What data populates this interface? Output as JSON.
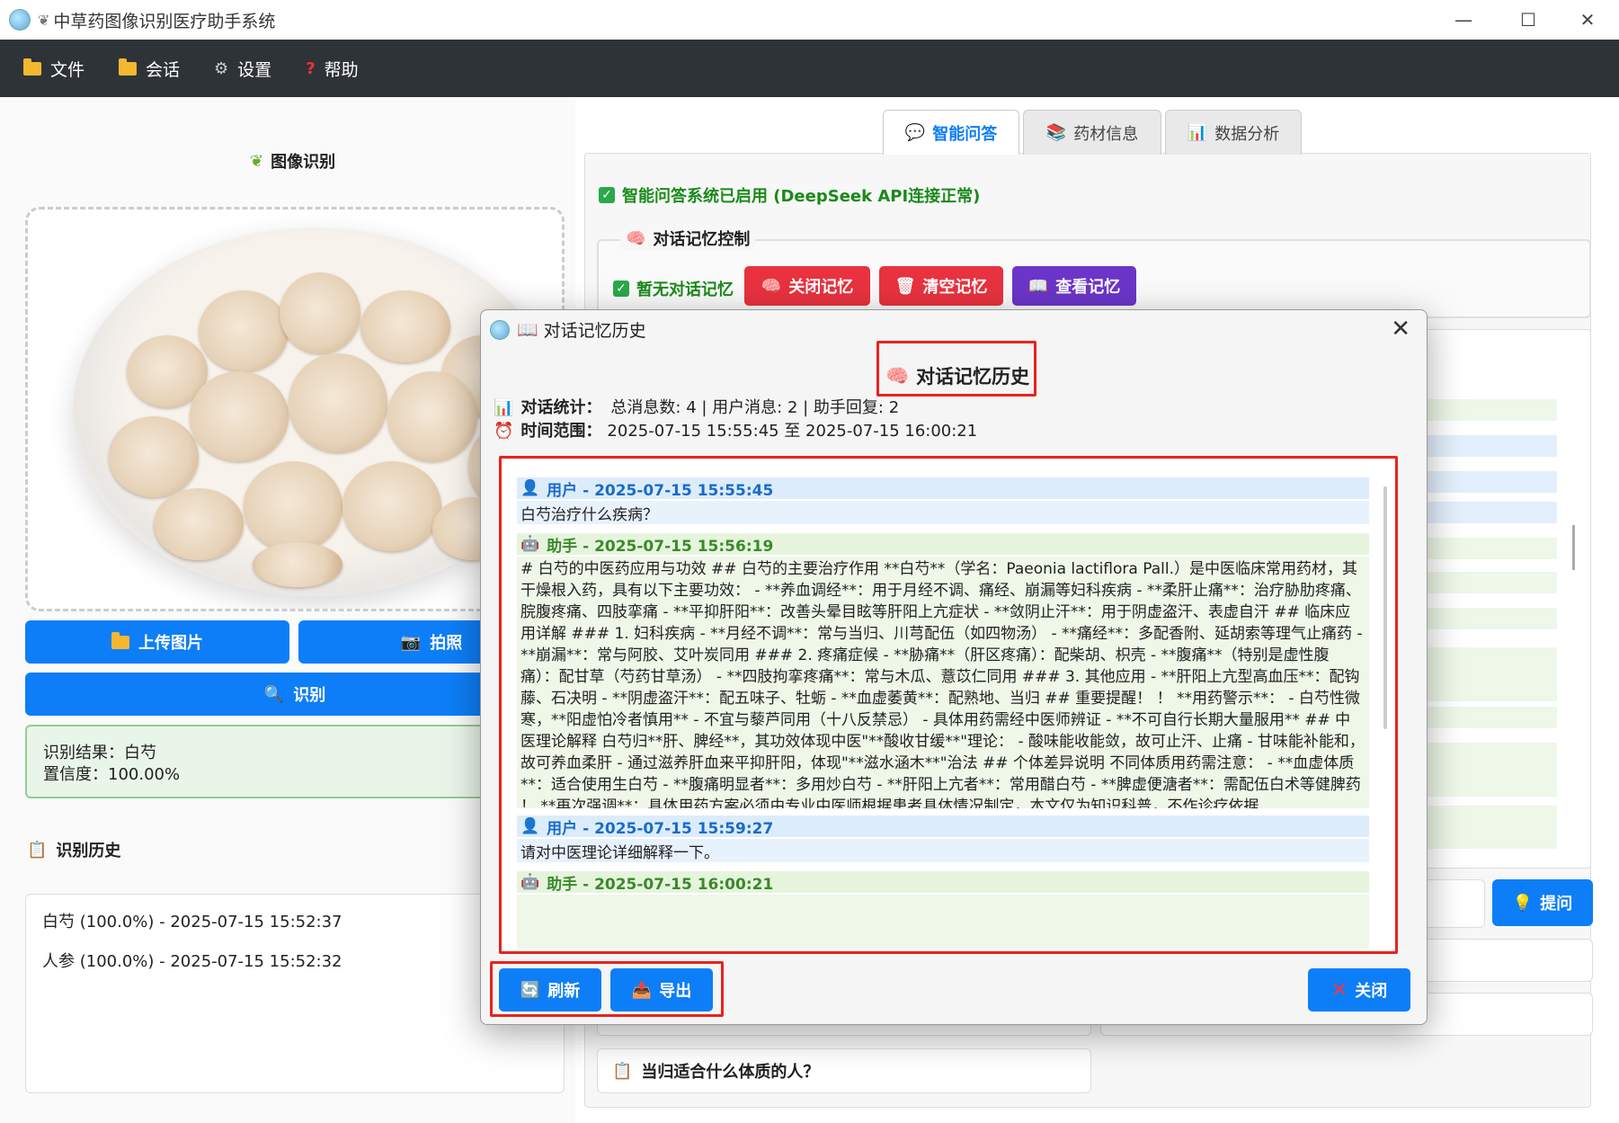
{
  "window": {
    "title": "中草药图像识别医疗助手系统",
    "minimize": "—",
    "maximize": "☐",
    "close": "✕"
  },
  "menu": [
    {
      "label": "文件"
    },
    {
      "label": "会话"
    },
    {
      "label": "设置"
    },
    {
      "label": "帮助"
    }
  ],
  "left": {
    "title": "图像识别",
    "upload_label": "上传图片",
    "camera_label": "拍照",
    "identify_label": "识别",
    "result_line1": "识别结果：白芍",
    "result_line2": "置信度：100.00%",
    "history_title": "识别历史",
    "history": [
      "白芍 (100.0%) - 2025-07-15 15:52:37",
      "人参 (100.0%) - 2025-07-15 15:52:32"
    ]
  },
  "right": {
    "tabs": [
      {
        "label": "智能问答"
      },
      {
        "label": "药材信息"
      },
      {
        "label": "数据分析"
      }
    ],
    "status": "智能问答系统已启用 (DeepSeek API连接正常)",
    "memory_group": "对话记忆控制",
    "memory_status": "暂无对话记忆",
    "btn_close_memory": "关闭记忆",
    "btn_clear_memory": "清空记忆",
    "btn_view_memory": "查看记忆",
    "ask_label": "提问",
    "suggestion": "当归适合什么体质的人？"
  },
  "dialog": {
    "title": "对话记忆历史",
    "heading": "对话记忆历史",
    "stats_label": "对话统计：",
    "stats_value": "总消息数: 4 | 用户消息: 2 | 助手回复: 2",
    "range_label": "时间范围：",
    "range_value": "2025-07-15 15:55:45 至 2025-07-15 16:00:21",
    "messages": [
      {
        "header": "用户 - 2025-07-15 15:55:45",
        "text": "白芍治疗什么疾病？"
      },
      {
        "header": "助手 - 2025-07-15 15:56:19",
        "text": "# 白芍的中医药应用与功效 ## 白芍的主要治疗作用 **白芍**（学名：Paeonia lactiflora Pall.）是中医临床常用药材，其干燥根入药，具有以下主要功效： - **养血调经**：用于月经不调、痛经、崩漏等妇科疾病 - **柔肝止痛**：治疗胁肋疼痛、脘腹疼痛、四肢挛痛 - **平抑肝阳**：改善头晕目眩等肝阳上亢症状 - **敛阴止汗**：用于阴虚盗汗、表虚自汗 ## 临床应用详解 ### 1. 妇科疾病 - **月经不调**：常与当归、川芎配伍（如四物汤） - **痛经**：多配香附、延胡索等理气止痛药 - **崩漏**：常与阿胶、艾叶炭同用 ### 2. 疼痛症候 - **胁痛**（肝区疼痛）：配柴胡、枳壳 - **腹痛**（特别是虚性腹痛）：配甘草（芍药甘草汤） - **四肢拘挛疼痛**：常与木瓜、薏苡仁同用 ### 3. 其他应用 - **肝阳上亢型高血压**：配钩藤、石决明 - **阴虚盗汗**：配五味子、牡蛎 - **血虚萎黄**：配熟地、当归 ## 重要提醒！ ！ **用药警示**： - 白芍性微寒，**阳虚怕冷者慎用** - 不宜与藜芦同用（十八反禁忌） - 具体用药需经中医师辨证 - **不可自行长期大量服用** ## 中医理论解释 白芍归**肝、脾经**，其功效体现中医\"**酸收甘缓**\"理论： - 酸味能收能敛，故可止汗、止痛 - 甘味能补能和，故可养血柔肝 - 通过滋养肝血来平抑肝阳，体现\"**滋水涵木**\"治法 ## 个体差异说明 不同体质用药需注意： - **血虚体质**：适合使用生白芍 - **腹痛明显者**：多用炒白芍 - **肝阳上亢者**：常用醋白芍 - **脾虚便溏者**：需配伍白术等健脾药 ！ **再次强调**：具体用药方案必须由专业中医师根据患者具体情况制定，本文仅为知识科普，不作诊疗依据..."
      },
      {
        "header": "用户 - 2025-07-15 15:59:27",
        "text": "请对中医理论详细解释一下。"
      },
      {
        "header": "助手 - 2025-07-15 16:00:21",
        "text": ""
      }
    ],
    "refresh_label": "刷新",
    "export_label": "导出",
    "close_label": "关闭"
  },
  "colors": {
    "accent": "#0d7ef7",
    "menubar": "#2e3338",
    "red_button": "#e8323f",
    "purple_button": "#6b35c9",
    "highlight": "#e8231c"
  }
}
